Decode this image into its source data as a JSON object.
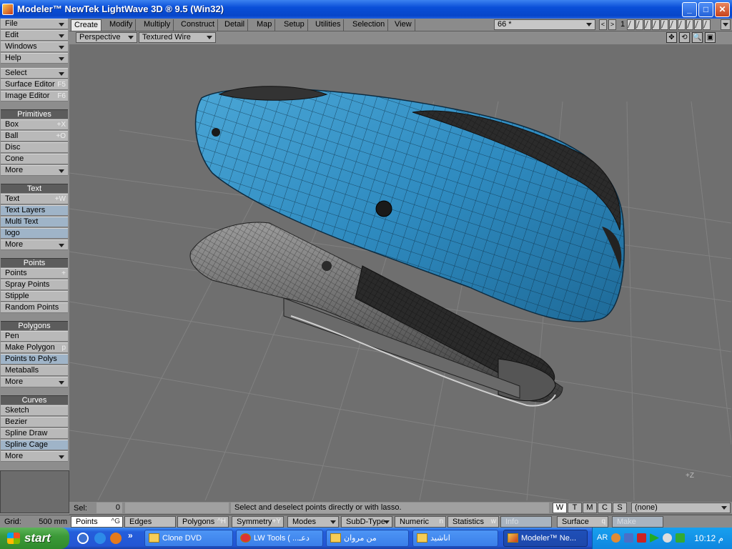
{
  "window": {
    "title": "Modeler™ NewTek LightWave 3D ® 9.5  (Win32)",
    "min": "_",
    "max": "□",
    "close": "✕"
  },
  "left_panel": {
    "menus": [
      {
        "label": "File"
      },
      {
        "label": "Edit"
      },
      {
        "label": "Windows"
      },
      {
        "label": "Help"
      }
    ],
    "top_tools": [
      {
        "label": "Select"
      },
      {
        "label": "Surface Editor",
        "key": "F5"
      },
      {
        "label": "Image Editor",
        "key": "F6"
      }
    ],
    "primitives": {
      "header": "Primitives",
      "items": [
        {
          "label": "Box",
          "key": "+X"
        },
        {
          "label": "Ball",
          "key": "+O"
        },
        {
          "label": "Disc"
        },
        {
          "label": "Cone"
        },
        {
          "label": "More"
        }
      ]
    },
    "text": {
      "header": "Text",
      "items": [
        {
          "label": "Text",
          "key": "+W"
        },
        {
          "label": "Text Layers"
        },
        {
          "label": "Multi Text"
        },
        {
          "label": "logo"
        },
        {
          "label": "More"
        }
      ]
    },
    "points": {
      "header": "Points",
      "items": [
        {
          "label": "Points",
          "key": "+"
        },
        {
          "label": "Spray Points"
        },
        {
          "label": "Stipple"
        },
        {
          "label": "Random Points"
        }
      ]
    },
    "polygons": {
      "header": "Polygons",
      "items": [
        {
          "label": "Pen"
        },
        {
          "label": "Make Polygon",
          "key": "p"
        },
        {
          "label": "Points to Polys"
        },
        {
          "label": "Metaballs"
        },
        {
          "label": "More"
        }
      ]
    },
    "curves": {
      "header": "Curves",
      "items": [
        {
          "label": "Sketch"
        },
        {
          "label": "Bezier"
        },
        {
          "label": "Spline Draw"
        },
        {
          "label": "Spline Cage"
        },
        {
          "label": "More"
        }
      ]
    }
  },
  "tabs": [
    "Create",
    "Modify",
    "Multiply",
    "Construct",
    "Detail",
    "Map",
    "Setup",
    "Utilities",
    "Selection",
    "View"
  ],
  "active_tab": "Create",
  "layer": {
    "name": "66 *",
    "prev": "<",
    "next": ">",
    "number": "1"
  },
  "viewport": {
    "view": "Perspective",
    "mode": "Textured Wire",
    "axis_label": "+Z"
  },
  "view_icons": [
    "✥",
    "⟲",
    "🔍",
    "▣"
  ],
  "status": {
    "sel_label": "Sel:",
    "sel_value": "0",
    "hint": "Select and deselect points directly or with lasso.",
    "wtmcs": [
      "W",
      "T",
      "M",
      "C",
      "S"
    ],
    "surface": "(none)"
  },
  "bottom": {
    "grid_label": "Grid:",
    "grid_value": "500 mm",
    "buttons": [
      {
        "label": "Points",
        "key": "^G"
      },
      {
        "label": "Edges"
      },
      {
        "label": "Polygons",
        "key": "^H"
      },
      {
        "label": "Symmetry",
        "key": "+Y"
      },
      {
        "label": "Modes"
      },
      {
        "label": "SubD-Type"
      },
      {
        "label": "Numeric",
        "key": "n"
      },
      {
        "label": "Statistics",
        "key": "w"
      },
      {
        "label": "Info"
      },
      {
        "label": "Surface",
        "key": "q"
      },
      {
        "label": "Make"
      }
    ]
  },
  "taskbar": {
    "start": "start",
    "tasks": [
      "Clone DVD",
      "LW Tools ( ...دعـ",
      "من مروان",
      "اناشيد",
      "Modeler™ Ne..."
    ],
    "lang": "AR",
    "clock": "10:12 م"
  },
  "colors": {
    "model_blue": "#2f8bc0",
    "viewport_bg": "#6f6f6f",
    "grid_line": "#808080"
  }
}
